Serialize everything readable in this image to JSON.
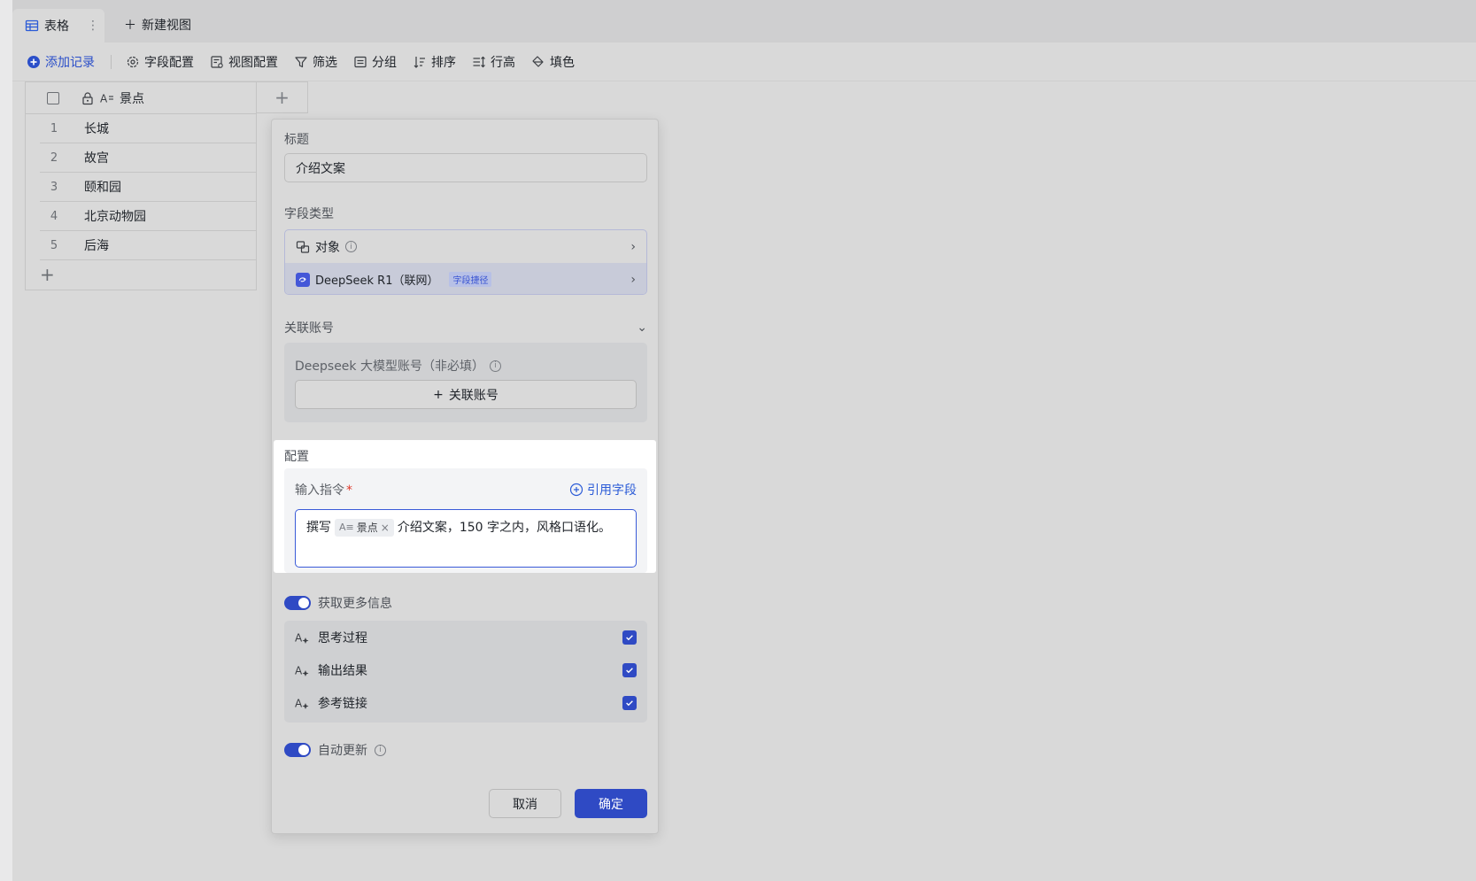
{
  "tabbar": {
    "tab_label": "表格",
    "new_view_label": "新建视图"
  },
  "toolbar": {
    "add_record": "添加记录",
    "field_config": "字段配置",
    "view_config": "视图配置",
    "filter": "筛选",
    "group": "分组",
    "sort": "排序",
    "row_height": "行高",
    "fill_color": "填色"
  },
  "grid": {
    "column_title": "景点",
    "rows": [
      {
        "num": "1",
        "value": "长城"
      },
      {
        "num": "2",
        "value": "故宫"
      },
      {
        "num": "3",
        "value": "颐和园"
      },
      {
        "num": "4",
        "value": "北京动物园"
      },
      {
        "num": "5",
        "value": "后海"
      }
    ]
  },
  "dialog": {
    "title_label": "标题",
    "title_value": "介绍文案",
    "field_type_label": "字段类型",
    "type_object": "对象",
    "type_model": "DeepSeek R1（联网）",
    "type_model_tag": "字段捷径",
    "account_label": "关联账号",
    "account_hint": "Deepseek 大模型账号（非必填）",
    "account_button": "关联账号",
    "config_label": "配置",
    "instruction_label": "输入指令",
    "reference_field": "引用字段",
    "prompt_prefix": "撰写",
    "prompt_chip": "景点",
    "prompt_suffix": "介绍文案，150 字之内，风格口语化。",
    "more_info_label": "获取更多信息",
    "outputs": [
      {
        "label": "思考过程"
      },
      {
        "label": "输出结果"
      },
      {
        "label": "参考链接"
      }
    ],
    "auto_update_label": "自动更新",
    "cancel": "取消",
    "confirm": "确定"
  }
}
